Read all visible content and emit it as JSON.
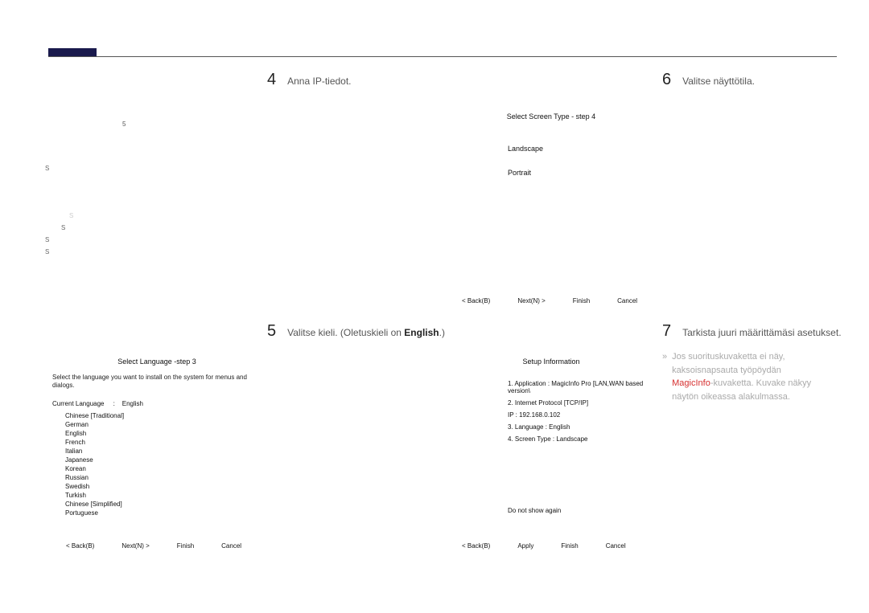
{
  "steps": {
    "s4": {
      "num": "4",
      "text": "Anna IP-tiedot."
    },
    "s5": {
      "num": "5",
      "text_prefix": "Valitse kieli. (Oletuskieli on ",
      "text_bold": "English",
      "text_suffix": ".)"
    },
    "s6": {
      "num": "6",
      "text": "Valitse näyttötila."
    },
    "s7": {
      "num": "7",
      "text": "Tarkista juuri määrittämäsi asetukset."
    }
  },
  "left_marks": {
    "n5": "5",
    "s1": "S",
    "s2": "S",
    "s3": "S",
    "s4": "S",
    "s_faint": "S"
  },
  "lang_panel": {
    "title": "Select Language -step 3",
    "desc": "Select the language you want to install on the system for menus and dialogs.",
    "current_label": "Current Language",
    "current_sep": ":",
    "current_value": "English",
    "items": [
      "Chinese [Traditional]",
      "German",
      "English",
      "French",
      "Italian",
      "Japanese",
      "Korean",
      "Russian",
      "Swedish",
      "Turkish",
      "Chinese [Simplified]",
      "Portuguese"
    ]
  },
  "screen_panel": {
    "title": "Select Screen Type - step 4",
    "opt1": "Landscape",
    "opt2": "Portrait"
  },
  "setup_panel": {
    "title": "Setup Information",
    "r1": "1. Application :     MagicInfo Pro [LAN,WAN based version\\",
    "r2": "2. Internet Protocol [TCP/IP]",
    "r3": "    IP :      192.168.0.102",
    "r4": "3. Language :     English",
    "r5": "4. Screen Type :    Landscape",
    "do_not": "Do not show again"
  },
  "btns": {
    "back": "<  Back(B)",
    "next": "Next(N)  >",
    "finish": "Finish",
    "cancel": "Cancel",
    "apply": "Apply"
  },
  "note": {
    "bullet": "»",
    "l1": "Jos suorituskuvaketta ei näy,",
    "l2_a": "kaksoisnapsauta työpöydän",
    "l3_hi": "MagicInfo",
    "l3_rest": "-kuvaketta. Kuvake näkyy",
    "l4": "näytön oikeassa alakulmassa."
  }
}
